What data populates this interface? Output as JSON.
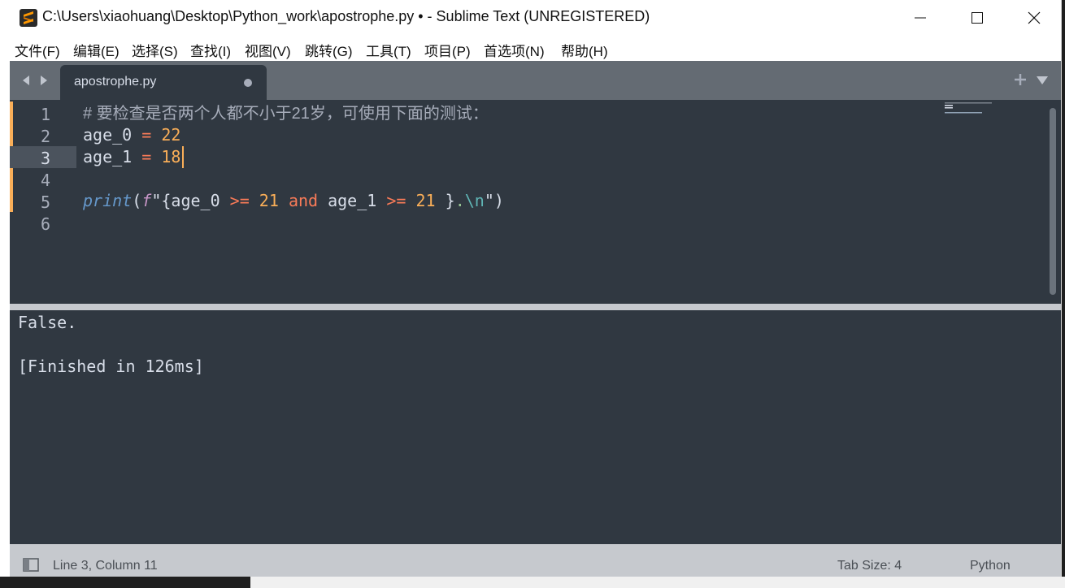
{
  "window": {
    "title": "C:\\Users\\xiaohuang\\Desktop\\Python_work\\apostrophe.py • - Sublime Text (UNREGISTERED)"
  },
  "menu": [
    {
      "label": "文件(F)",
      "key": "file"
    },
    {
      "label": "编辑(E)",
      "key": "edit"
    },
    {
      "label": "选择(S)",
      "key": "selection"
    },
    {
      "label": "查找(I)",
      "key": "find"
    },
    {
      "label": "视图(V)",
      "key": "view"
    },
    {
      "label": "跳转(G)",
      "key": "goto"
    },
    {
      "label": "工具(T)",
      "key": "tools"
    },
    {
      "label": "项目(P)",
      "key": "project"
    },
    {
      "label": "首选项(N)",
      "key": "preferences"
    },
    {
      "label": "帮助(H)",
      "key": "help"
    }
  ],
  "tab": {
    "filename": "apostrophe.py",
    "dirty": true
  },
  "editor": {
    "active_line": 3,
    "lines": [
      {
        "n": "1",
        "tokens": [
          {
            "t": "# 要检查是否两个人都不小于21岁，可使用下面的测试：",
            "c": "comment"
          }
        ]
      },
      {
        "n": "2",
        "tokens": [
          {
            "t": "age_0",
            "c": "plain"
          },
          {
            "t": " = ",
            "c": "op"
          },
          {
            "t": "22",
            "c": "num"
          }
        ]
      },
      {
        "n": "3",
        "tokens": [
          {
            "t": "age_1",
            "c": "plain"
          },
          {
            "t": " = ",
            "c": "op"
          },
          {
            "t": "18",
            "c": "num"
          }
        ]
      },
      {
        "n": "4",
        "tokens": []
      },
      {
        "n": "5",
        "tokens": [
          {
            "t": "print",
            "c": "fn"
          },
          {
            "t": "(",
            "c": "plain"
          },
          {
            "t": "f",
            "c": "pfx"
          },
          {
            "t": "\"",
            "c": "plain"
          },
          {
            "t": "{age_0 ",
            "c": "plain"
          },
          {
            "t": ">=",
            "c": "op"
          },
          {
            "t": " ",
            "c": "plain"
          },
          {
            "t": "21",
            "c": "num"
          },
          {
            "t": " ",
            "c": "plain"
          },
          {
            "t": "and",
            "c": "kw"
          },
          {
            "t": " age_1 ",
            "c": "plain"
          },
          {
            "t": ">=",
            "c": "op"
          },
          {
            "t": " ",
            "c": "plain"
          },
          {
            "t": "21",
            "c": "num"
          },
          {
            "t": " }",
            "c": "plain"
          },
          {
            "t": ".",
            "c": "str"
          },
          {
            "t": "\\n",
            "c": "esc"
          },
          {
            "t": "\"",
            "c": "plain"
          },
          {
            "t": ")",
            "c": "plain"
          }
        ]
      },
      {
        "n": "6",
        "tokens": []
      }
    ]
  },
  "output": {
    "lines": [
      "False.",
      "",
      "[Finished in 126ms]"
    ]
  },
  "status": {
    "position": "Line 3, Column 11",
    "tab_size": "Tab Size: 4",
    "syntax": "Python"
  },
  "colors": {
    "background": "#303841",
    "foreground": "#d8dee9",
    "orange": "#f9ae58",
    "red_orange": "#f97b58",
    "blue": "#6699cc",
    "purple": "#c695c6",
    "green": "#99c794",
    "cyan": "#5fb4b4",
    "comment": "#a7adba"
  },
  "icons": {
    "app": "sublime-text-icon",
    "nav": [
      "chevron-left-icon",
      "chevron-right-icon"
    ],
    "tab_actions": [
      "plus-icon",
      "chevron-down-icon"
    ],
    "window": [
      "minimize-icon",
      "maximize-icon",
      "close-icon"
    ],
    "status": "panel-toggle-icon"
  }
}
